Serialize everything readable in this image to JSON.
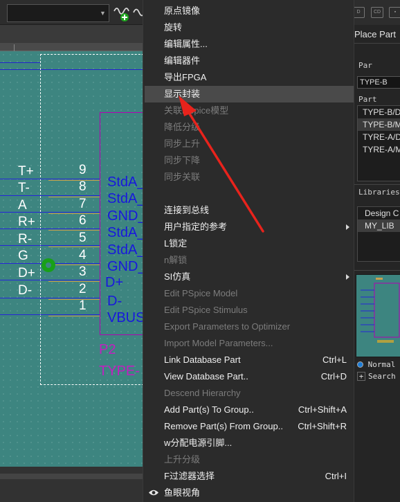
{
  "toolbar": {
    "combo_value": ""
  },
  "schematic": {
    "signals": [
      "T+",
      "T-",
      "A",
      "R+",
      "R-",
      "G",
      "D+",
      "D-"
    ],
    "pin_numbers": [
      "9",
      "8",
      "7",
      "6",
      "5",
      "4",
      "3",
      "2",
      "1"
    ],
    "pin_names": [
      "StdA_",
      "StdA_",
      "GND_",
      "StdA_",
      "StdA_",
      "GND_",
      "D+",
      "D-",
      "VBUS"
    ],
    "ref_designator": "P2",
    "part_value": "TYPE-"
  },
  "context_menu": {
    "items": [
      {
        "label": "原点镜像",
        "shortcut": "",
        "disabled": false
      },
      {
        "label": "旋转",
        "shortcut": "",
        "disabled": false
      },
      {
        "label": "编辑属性...",
        "shortcut": "",
        "disabled": false
      },
      {
        "label": "编辑器件",
        "shortcut": "",
        "disabled": false
      },
      {
        "label": "导出FPGA",
        "shortcut": "",
        "disabled": false
      },
      {
        "label": "显示封装",
        "shortcut": "",
        "disabled": false,
        "highlighted": true
      },
      {
        "label": "关联PSpice模型",
        "shortcut": "",
        "disabled": true
      },
      {
        "label": "降低分级",
        "shortcut": "",
        "disabled": true
      },
      {
        "label": "同步上升",
        "shortcut": "",
        "disabled": true
      },
      {
        "label": "同步下降",
        "shortcut": "",
        "disabled": true
      },
      {
        "label": "同步关联",
        "shortcut": "",
        "disabled": true
      },
      {
        "label": "连接到总线",
        "shortcut": "",
        "disabled": false
      },
      {
        "label": "用户指定的参考",
        "shortcut": "",
        "disabled": false,
        "submenu": true
      },
      {
        "label": "L锁定",
        "shortcut": "",
        "disabled": false
      },
      {
        "label": "n解锁",
        "shortcut": "",
        "disabled": true
      },
      {
        "label": "SI仿真",
        "shortcut": "",
        "disabled": false,
        "submenu": true
      },
      {
        "label": "Edit PSpice Model",
        "shortcut": "",
        "disabled": true
      },
      {
        "label": "Edit PSpice Stimulus",
        "shortcut": "",
        "disabled": true
      },
      {
        "label": "Export Parameters to Optimizer",
        "shortcut": "",
        "disabled": true
      },
      {
        "label": "Import Model Parameters...",
        "shortcut": "",
        "disabled": true
      },
      {
        "label": "Link Database Part",
        "shortcut": "Ctrl+L",
        "disabled": false
      },
      {
        "label": "View Database Part..",
        "shortcut": "Ctrl+D",
        "disabled": false
      },
      {
        "label": "Descend Hierarchy",
        "shortcut": "",
        "disabled": true
      },
      {
        "label": "Add Part(s) To Group..",
        "shortcut": "Ctrl+Shift+A",
        "disabled": false
      },
      {
        "label": "Remove Part(s) From Group..",
        "shortcut": "Ctrl+Shift+R",
        "disabled": false
      },
      {
        "label": "w分配电源引脚...",
        "shortcut": "",
        "disabled": false
      },
      {
        "label": "上升分级",
        "shortcut": "",
        "disabled": true
      },
      {
        "label": "F过滤器选择",
        "shortcut": "Ctrl+I",
        "disabled": false
      },
      {
        "label": "鱼眼视角",
        "shortcut": "",
        "disabled": false,
        "icon": "eye-icon"
      }
    ]
  },
  "place_part": {
    "title": "Place Part",
    "part_label": "Par",
    "part_value": "TYPE-B",
    "part_list_label": "Part",
    "parts": [
      "TYPE-B/D",
      "TYPE-B/M",
      "TYRE-A/D",
      "TYRE-A/M"
    ],
    "selected_part_index": 1,
    "libraries_label": "Libraries:",
    "libraries": [
      "Design C",
      "MY_LIB"
    ],
    "selected_library_index": 1,
    "view_mode": "Normal",
    "search_label": "Search"
  },
  "colors": {
    "canvas": "#3d8580",
    "wire": "#2525d8",
    "part_outline": "#b400b4",
    "annotation_arrow": "#e8231c"
  }
}
